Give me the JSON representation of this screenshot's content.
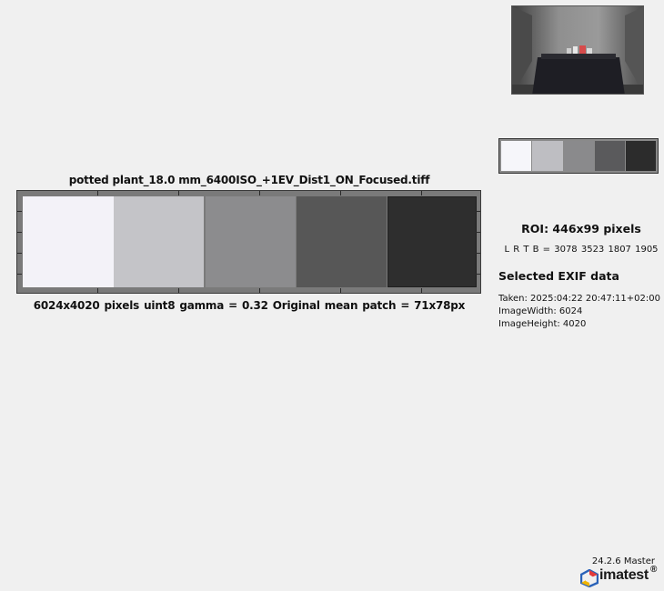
{
  "plot": {
    "title": "potted plant_18.0 mm_6400ISO_+1EV_Dist1_ON_Focused.tiff",
    "caption": "6024x4020 pixels    uint8    gamma = 0.32   Original    mean patch = 71x78px"
  },
  "patches": [
    {
      "name": "patch-1",
      "color": "#f3f2f8"
    },
    {
      "name": "patch-2",
      "color": "#c4c4c8"
    },
    {
      "name": "patch-3",
      "color": "#8c8c8e"
    },
    {
      "name": "patch-4",
      "color": "#575757"
    },
    {
      "name": "patch-5",
      "color": "#2e2e2e"
    }
  ],
  "roi": {
    "title": "ROI:  446x99 pixels",
    "coords": "L R  T B = 3078 3523  1807 1905"
  },
  "exif": {
    "title": "Selected EXIF data",
    "lines": [
      "Taken: 2025:04:22 20:47:11+02:00",
      "ImageWidth:  6024",
      "ImageHeight:  4020"
    ]
  },
  "footer": {
    "version": "24.2.6 Master",
    "logo_text": "imatest",
    "logo_reg": "®"
  }
}
